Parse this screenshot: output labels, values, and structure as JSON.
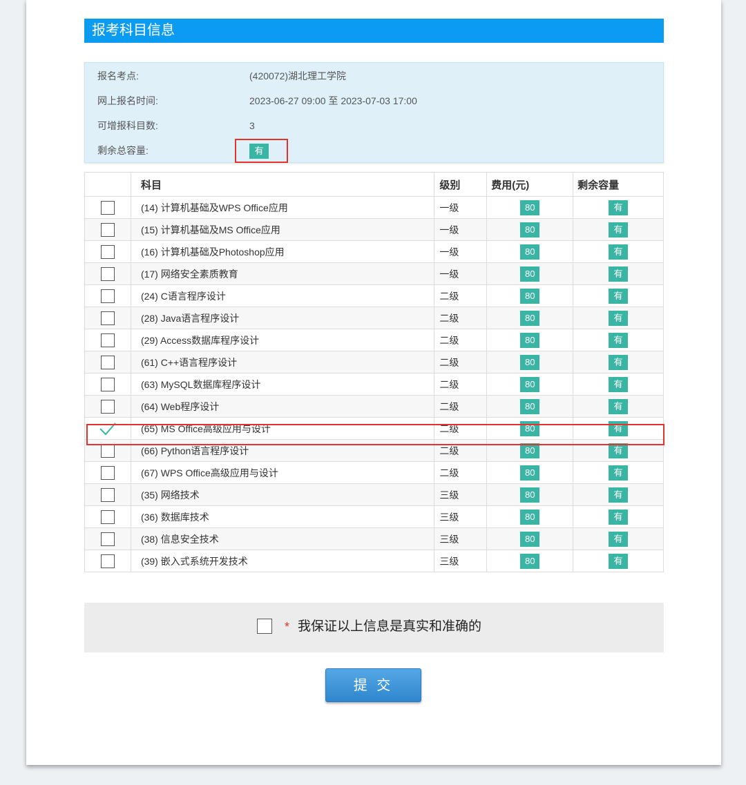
{
  "section": {
    "title": "报考科目信息"
  },
  "info": {
    "site_label": "报名考点:",
    "site_value": "(420072)湖北理工学院",
    "time_label": "网上报名时间:",
    "time_value": "2023-06-27 09:00 至 2023-07-03 17:00",
    "count_label": "可增报科目数:",
    "count_value": "3",
    "capacity_label": "剩余总容量:",
    "capacity_value": "有"
  },
  "table": {
    "headers": {
      "subject": "科目",
      "level": "级别",
      "fee": "费用(元)",
      "capacity": "剩余容量"
    },
    "rows": [
      {
        "name": "(14) 计算机基础及WPS Office应用",
        "level": "一级",
        "fee": "80",
        "capacity": "有",
        "checked": false
      },
      {
        "name": "(15) 计算机基础及MS Office应用",
        "level": "一级",
        "fee": "80",
        "capacity": "有",
        "checked": false
      },
      {
        "name": "(16) 计算机基础及Photoshop应用",
        "level": "一级",
        "fee": "80",
        "capacity": "有",
        "checked": false
      },
      {
        "name": "(17) 网络安全素质教育",
        "level": "一级",
        "fee": "80",
        "capacity": "有",
        "checked": false
      },
      {
        "name": "(24) C语言程序设计",
        "level": "二级",
        "fee": "80",
        "capacity": "有",
        "checked": false
      },
      {
        "name": "(28) Java语言程序设计",
        "level": "二级",
        "fee": "80",
        "capacity": "有",
        "checked": false
      },
      {
        "name": "(29) Access数据库程序设计",
        "level": "二级",
        "fee": "80",
        "capacity": "有",
        "checked": false
      },
      {
        "name": "(61) C++语言程序设计",
        "level": "二级",
        "fee": "80",
        "capacity": "有",
        "checked": false
      },
      {
        "name": "(63) MySQL数据库程序设计",
        "level": "二级",
        "fee": "80",
        "capacity": "有",
        "checked": false
      },
      {
        "name": "(64) Web程序设计",
        "level": "二级",
        "fee": "80",
        "capacity": "有",
        "checked": false
      },
      {
        "name": "(65) MS Office高级应用与设计",
        "level": "二级",
        "fee": "80",
        "capacity": "有",
        "checked": true
      },
      {
        "name": "(66) Python语言程序设计",
        "level": "二级",
        "fee": "80",
        "capacity": "有",
        "checked": false
      },
      {
        "name": "(67) WPS Office高级应用与设计",
        "level": "二级",
        "fee": "80",
        "capacity": "有",
        "checked": false
      },
      {
        "name": "(35) 网络技术",
        "level": "三级",
        "fee": "80",
        "capacity": "有",
        "checked": false
      },
      {
        "name": "(36) 数据库技术",
        "level": "三级",
        "fee": "80",
        "capacity": "有",
        "checked": false
      },
      {
        "name": "(38) 信息安全技术",
        "level": "三级",
        "fee": "80",
        "capacity": "有",
        "checked": false
      },
      {
        "name": "(39) 嵌入式系统开发技术",
        "level": "三级",
        "fee": "80",
        "capacity": "有",
        "checked": false
      }
    ]
  },
  "agreement": {
    "star": "*",
    "text": "我保证以上信息是真实和准确的"
  },
  "submit": {
    "label": "提 交"
  },
  "colors": {
    "accent_bar": "#0b9cf1",
    "badge": "#3bb5a3",
    "highlight": "#e5322d",
    "info_bg": "#dff0f9"
  }
}
